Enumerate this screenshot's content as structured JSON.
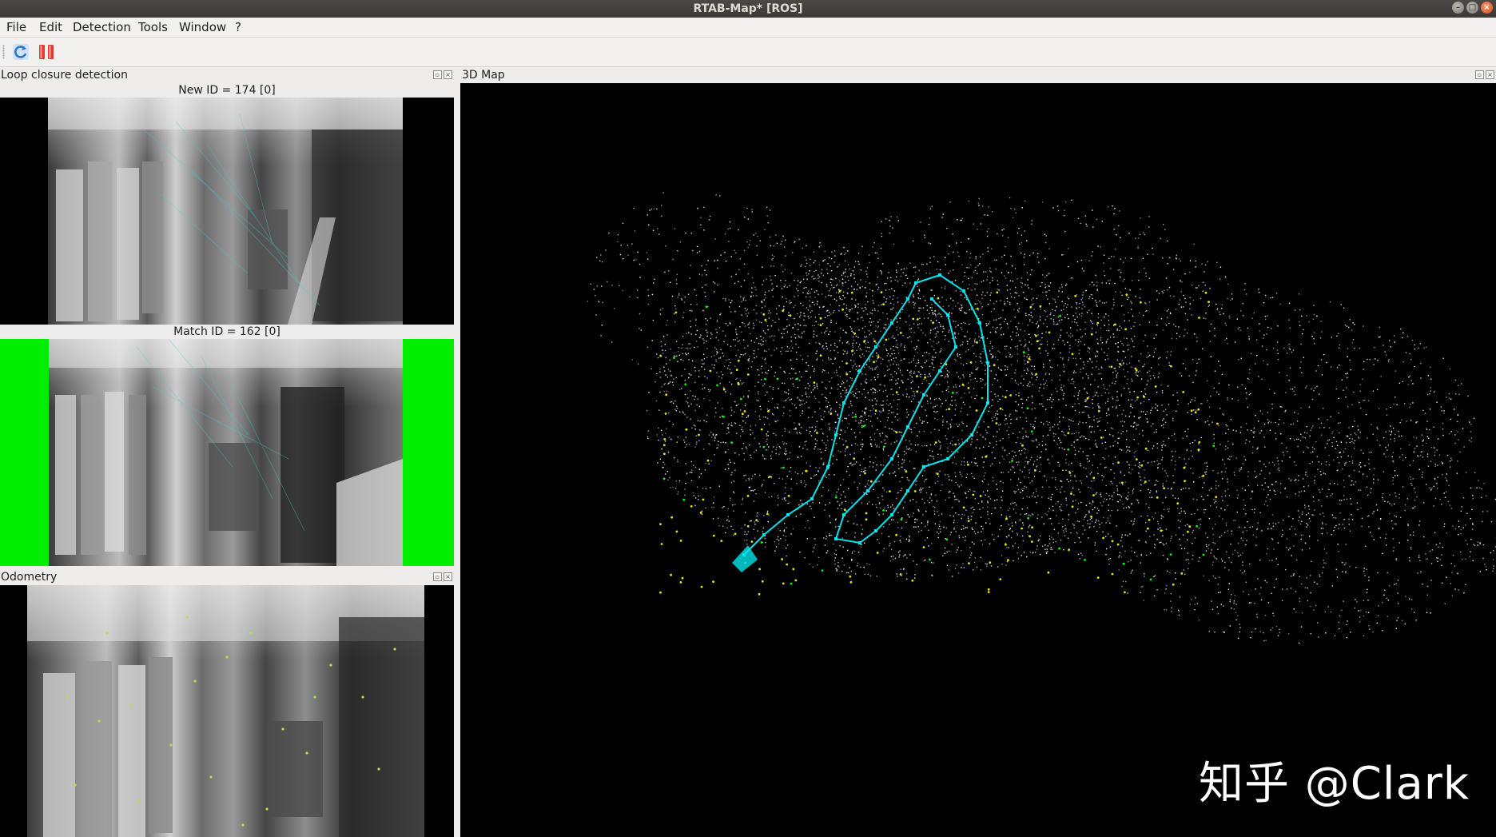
{
  "window": {
    "title": "RTAB-Map* [ROS]",
    "buttons": [
      "minimize",
      "maximize",
      "close"
    ]
  },
  "menu": {
    "items": [
      "File",
      "Edit",
      "Detection",
      "Tools",
      "Window",
      "?"
    ]
  },
  "toolbar": {
    "buttons": [
      {
        "name": "refresh",
        "icon": "refresh-icon"
      },
      {
        "name": "pause",
        "icon": "pause-icon"
      }
    ]
  },
  "loop_closure": {
    "title": "Loop closure detection",
    "new_id": "New ID = 174 [0]",
    "match_id": "Match ID = 162 [0]"
  },
  "odometry": {
    "title": "Odometry"
  },
  "map3d": {
    "title": "3D Map",
    "graph_color": "#00e5ee",
    "feature_color": "#e6e600",
    "loop_highlight_color": "#00ff00"
  },
  "watermark": "知乎 @Clark"
}
